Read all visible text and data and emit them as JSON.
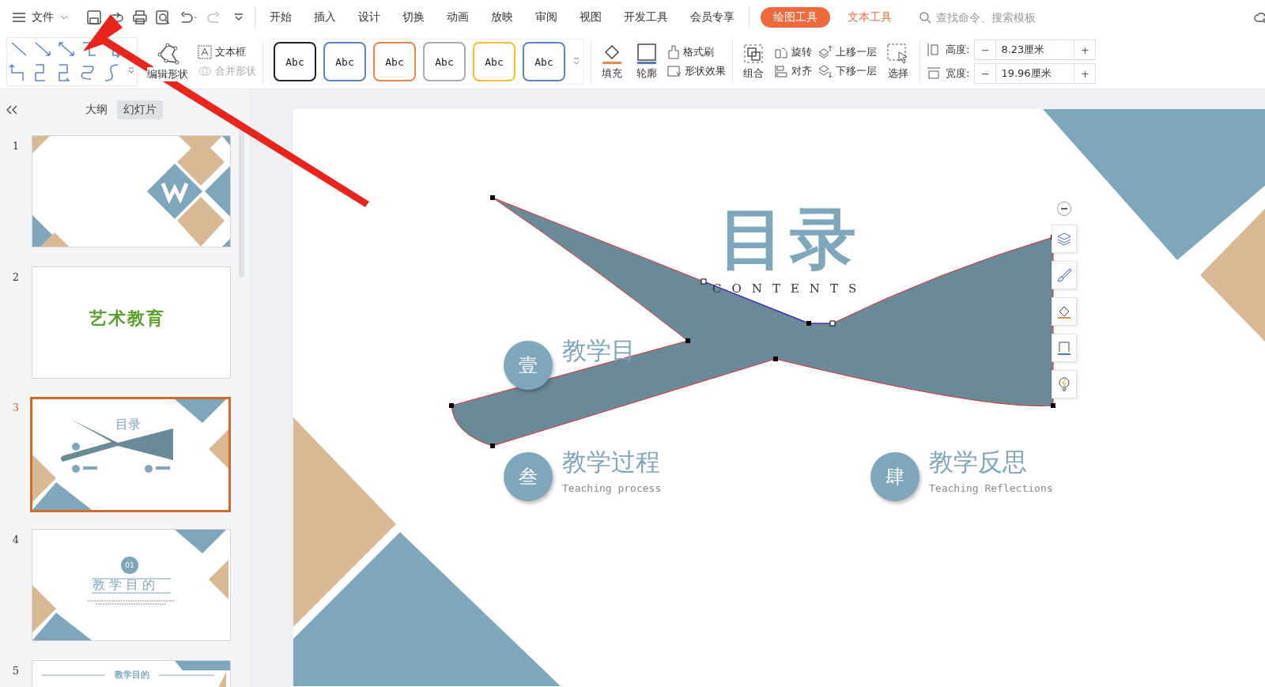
{
  "menu": {
    "file": "文件",
    "tabs": [
      {
        "label": "开始",
        "selected": false
      },
      {
        "label": "插入",
        "selected": false
      },
      {
        "label": "设计",
        "selected": false
      },
      {
        "label": "切换",
        "selected": false
      },
      {
        "label": "动画",
        "selected": false
      },
      {
        "label": "放映",
        "selected": false
      },
      {
        "label": "审阅",
        "selected": false
      },
      {
        "label": "视图",
        "selected": false
      },
      {
        "label": "开发工具",
        "selected": false
      },
      {
        "label": "会员专享",
        "selected": false
      }
    ],
    "context_tabs": [
      {
        "label": "绘图工具",
        "selected": true
      },
      {
        "label": "文本工具",
        "selected": false
      }
    ],
    "search": {
      "placeholder": "查找命令、搜索模板"
    }
  },
  "ribbon": {
    "edit_shape": "编辑形状",
    "text_box": "文本框",
    "merge_shape": {
      "label": "合并形状",
      "disabled": true
    },
    "styles": [
      {
        "label": "Abc",
        "color": "#222222"
      },
      {
        "label": "Abc",
        "color": "#5b86c6"
      },
      {
        "label": "Abc",
        "color": "#e8884a"
      },
      {
        "label": "Abc",
        "color": "#aaaaaa"
      },
      {
        "label": "Abc",
        "color": "#f2c12e"
      },
      {
        "label": "Abc",
        "color": "#5b86c6"
      }
    ],
    "fill": "填充",
    "outline": "轮廓",
    "format_painter": "格式刷",
    "shape_effects": "形状效果",
    "group": "组合",
    "rotate": "旋转",
    "align": "对齐",
    "bring_forward": "上移一层",
    "send_backward": "下移一层",
    "select": "选择",
    "size": [
      {
        "label": "高度:",
        "value": "8.23厘米",
        "minus": "−",
        "plus": "+"
      },
      {
        "label": "宽度:",
        "value": "19.96厘米",
        "minus": "−",
        "plus": "+"
      }
    ]
  },
  "sidebar": {
    "tabs": [
      {
        "label": "大纲",
        "selected": false
      },
      {
        "label": "幻灯片",
        "selected": true
      }
    ],
    "slides": [
      {
        "number": "1",
        "kind": "cover",
        "selected": false
      },
      {
        "number": "2",
        "kind": "title",
        "title": "艺术教育",
        "selected": false
      },
      {
        "number": "3",
        "kind": "contents",
        "title": "目录",
        "selected": true
      },
      {
        "number": "4",
        "kind": "section",
        "badge": "01",
        "title": "教 学 目 的",
        "selected": false
      },
      {
        "number": "5",
        "kind": "heading",
        "title": "教学目的",
        "selected": false
      }
    ]
  },
  "slide": {
    "title": "目录",
    "subtitle": "CONTENTS",
    "items": [
      {
        "number": "壹",
        "title": "教学目"
      },
      {
        "number": "叁",
        "title": "教学过程",
        "subtitle": "Teaching process"
      },
      {
        "number": "肆",
        "title": "教学反思",
        "subtitle": "Teaching Reflections"
      }
    ]
  }
}
